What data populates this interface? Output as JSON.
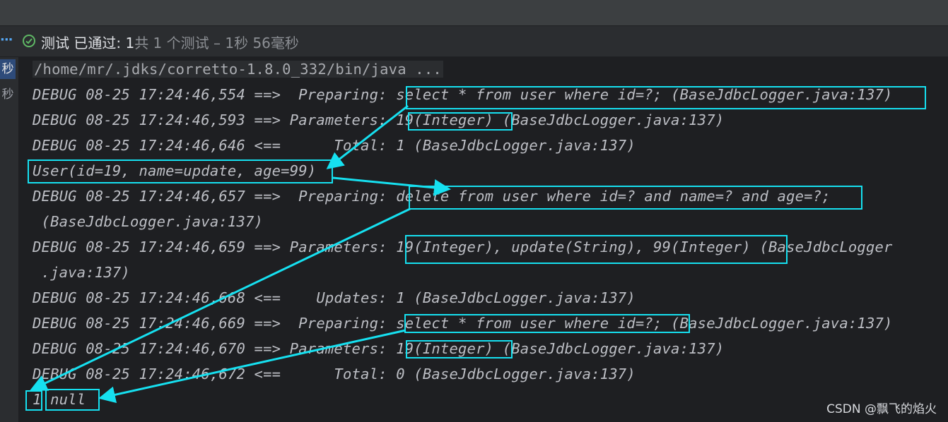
{
  "test_status": {
    "label": "测试 已通过: ",
    "passed_count": "1",
    "summary": "共 1 个测试",
    "separator": " – ",
    "duration": "1秒 56毫秒"
  },
  "side_panel": {
    "items": [
      "秒",
      "秒"
    ]
  },
  "console_lines": [
    "/home/mr/.jdks/corretto-1.8.0_332/bin/java ...",
    "DEBUG 08-25 17:24:46,554 ==>  Preparing: select * from user where id=?; (BaseJdbcLogger.java:137)",
    "DEBUG 08-25 17:24:46,593 ==> Parameters: 19(Integer) (BaseJdbcLogger.java:137)",
    "DEBUG 08-25 17:24:46,646 <==      Total: 1 (BaseJdbcLogger.java:137)",
    "User(id=19, name=update, age=99)",
    "DEBUG 08-25 17:24:46,657 ==>  Preparing: delete from user where id=? and name=? and age=?;",
    " (BaseJdbcLogger.java:137)",
    "DEBUG 08-25 17:24:46,659 ==> Parameters: 19(Integer), update(String), 99(Integer) (BaseJdbcLogger",
    " .java:137)",
    "DEBUG 08-25 17:24:46,668 <==    Updates: 1 (BaseJdbcLogger.java:137)",
    "DEBUG 08-25 17:24:46,669 ==>  Preparing: select * from user where id=?; (BaseJdbcLogger.java:137)",
    "DEBUG 08-25 17:24:46,670 ==> Parameters: 19(Integer) (BaseJdbcLogger.java:137)",
    "DEBUG 08-25 17:24:46,672 <==      Total: 0 (BaseJdbcLogger.java:137)",
    "1 null"
  ],
  "watermark": "CSDN @飘飞的焰火",
  "colors": {
    "highlight": "#16e0f0",
    "pass_green": "#5fb865",
    "console_bg": "#1e1f22"
  }
}
